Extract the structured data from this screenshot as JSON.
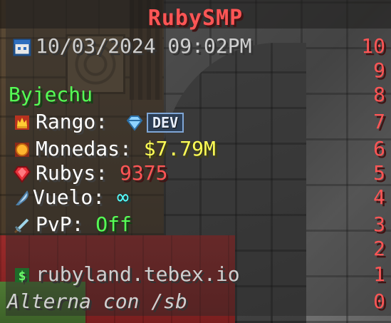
{
  "scoreboard": {
    "title": "RubySMP",
    "datetime": "10/03/2024 09:02PM",
    "player": "Byjechu",
    "rank_label": "Rango:",
    "rank_tag": "DEV",
    "coins_label": "Monedas:",
    "coins_value": "$7.79M",
    "rubies_label": "Rubys:",
    "rubies_value": "9375",
    "fly_label": "Vuelo:",
    "fly_value": "∞",
    "pvp_label": "PvP:",
    "pvp_value": "Off",
    "store": "rubyland.tebex.io",
    "toggle_hint": "Alterna con /sb",
    "scores": [
      "10",
      "9",
      "8",
      "7",
      "6",
      "5",
      "4",
      "3",
      "2",
      "1",
      "0"
    ]
  },
  "icons": {
    "calendar": "calendar-icon",
    "rank": "crown-icon",
    "rank_tag_icon": "diamond-icon",
    "coins": "coin-icon",
    "rubies": "ruby-icon",
    "fly": "feather-icon",
    "pvp": "sword-icon",
    "store": "dollar-icon"
  },
  "colors": {
    "title": "#ff5555",
    "player": "#55ff55",
    "coins": "#ffff55",
    "rubies": "#ff5555",
    "fly": "#55ffff",
    "pvp": "#55ff55",
    "scores": "#ff5555"
  }
}
